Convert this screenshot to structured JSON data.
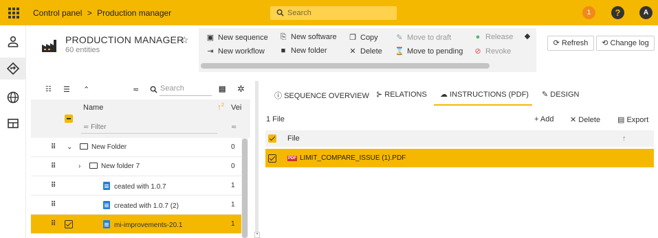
{
  "topbar": {
    "breadcrumb": [
      "Control panel",
      ">",
      "Production manager"
    ],
    "search_placeholder": "Search",
    "notification_count": "1",
    "help_label": "?",
    "avatar_initial": "A",
    "accent_color": "#f5b800"
  },
  "header": {
    "title": "PRODUCTION MANAGER",
    "star": "☆",
    "subtitle": "60 entities"
  },
  "toolbar": {
    "new_sequence": "New sequence",
    "new_software": "New software",
    "copy": "Copy",
    "move_to_draft": "Move to draft",
    "release": "Release",
    "new_workflow": "New workflow",
    "new_folder": "New folder",
    "delete": "Delete",
    "move_to_pending": "Move to pending",
    "revoke": "Revoke",
    "refresh": "Refresh",
    "change_log": "Change log"
  },
  "tree": {
    "search_placeholder": "Search",
    "col_name": "Name",
    "col_version": "Vei",
    "sort_badge": "2",
    "filter_placeholder": "Filter",
    "rows": [
      {
        "name": "New Folder",
        "version": "0",
        "type": "folder",
        "expander": "⌄"
      },
      {
        "name": "New folder 7",
        "version": "0",
        "type": "folder",
        "expander": "›"
      },
      {
        "name": "ceated with 1.0.7",
        "version": "1",
        "type": "doc"
      },
      {
        "name": "created with 1.0.7 (2)",
        "version": "1",
        "type": "doc"
      },
      {
        "name": "mi-improvements-20.1",
        "version": "1",
        "type": "doc",
        "selected": true
      }
    ]
  },
  "tabs": [
    {
      "label": "SEQUENCE OVERVIEW",
      "icon": "info-icon"
    },
    {
      "label": "RELATIONS",
      "icon": "relations-icon"
    },
    {
      "label": "INSTRUCTIONS (PDF)",
      "icon": "cloud-upload-icon",
      "active": true
    },
    {
      "label": "DESIGN",
      "icon": "pencil-icon"
    }
  ],
  "files": {
    "count": "1 File",
    "add": "Add",
    "delete": "Delete",
    "export": "Export",
    "col_file": "File",
    "rows": [
      {
        "name": "LIMIT_COMPARE_ISSUE (1).PDF",
        "badge": "PDF"
      }
    ]
  }
}
